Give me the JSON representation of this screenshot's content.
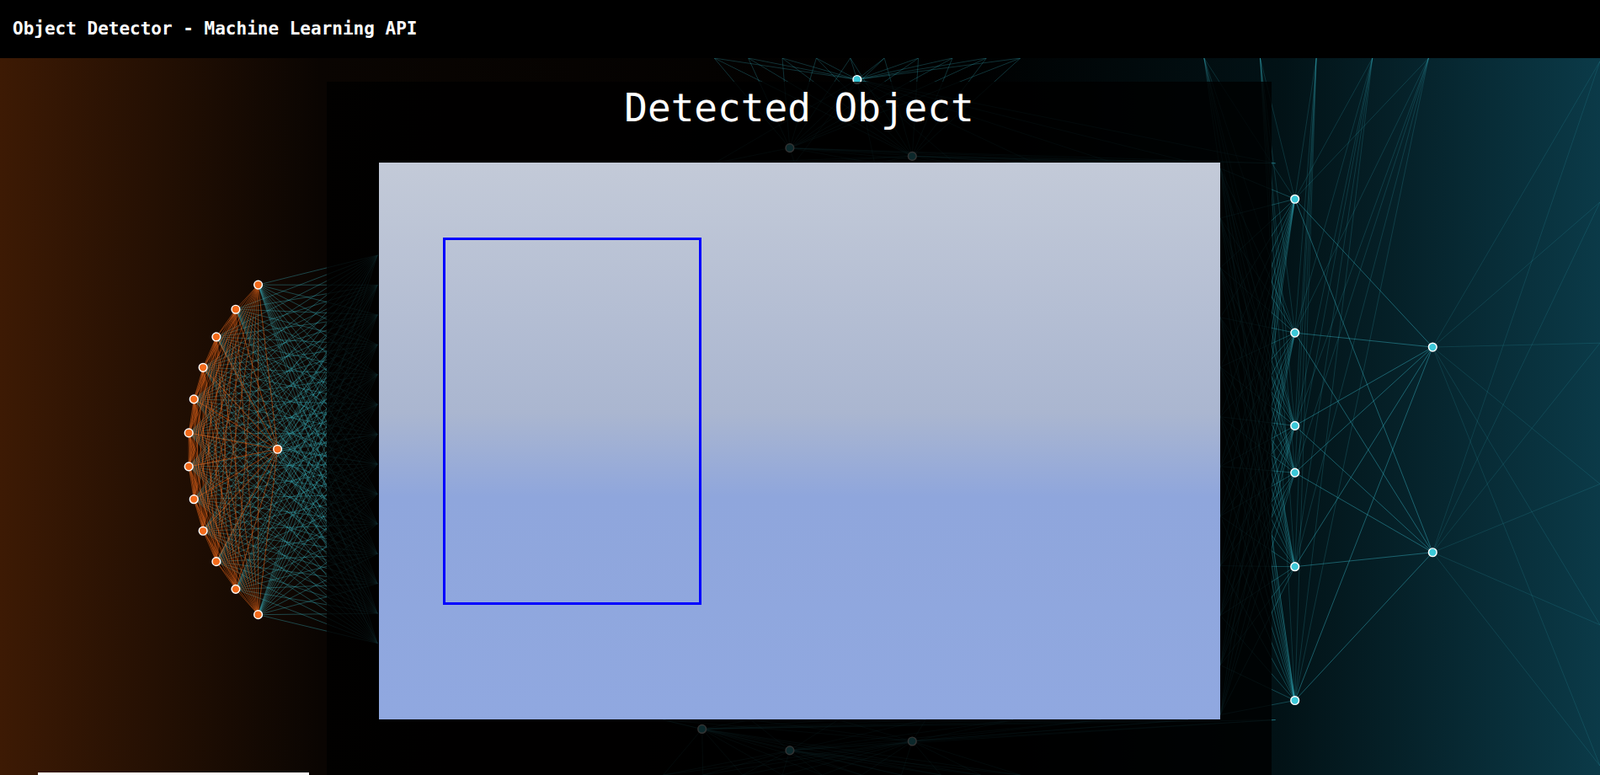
{
  "header": {
    "title": "Object Detector - Machine Learning API"
  },
  "panel": {
    "title": "Detected Object"
  }
}
